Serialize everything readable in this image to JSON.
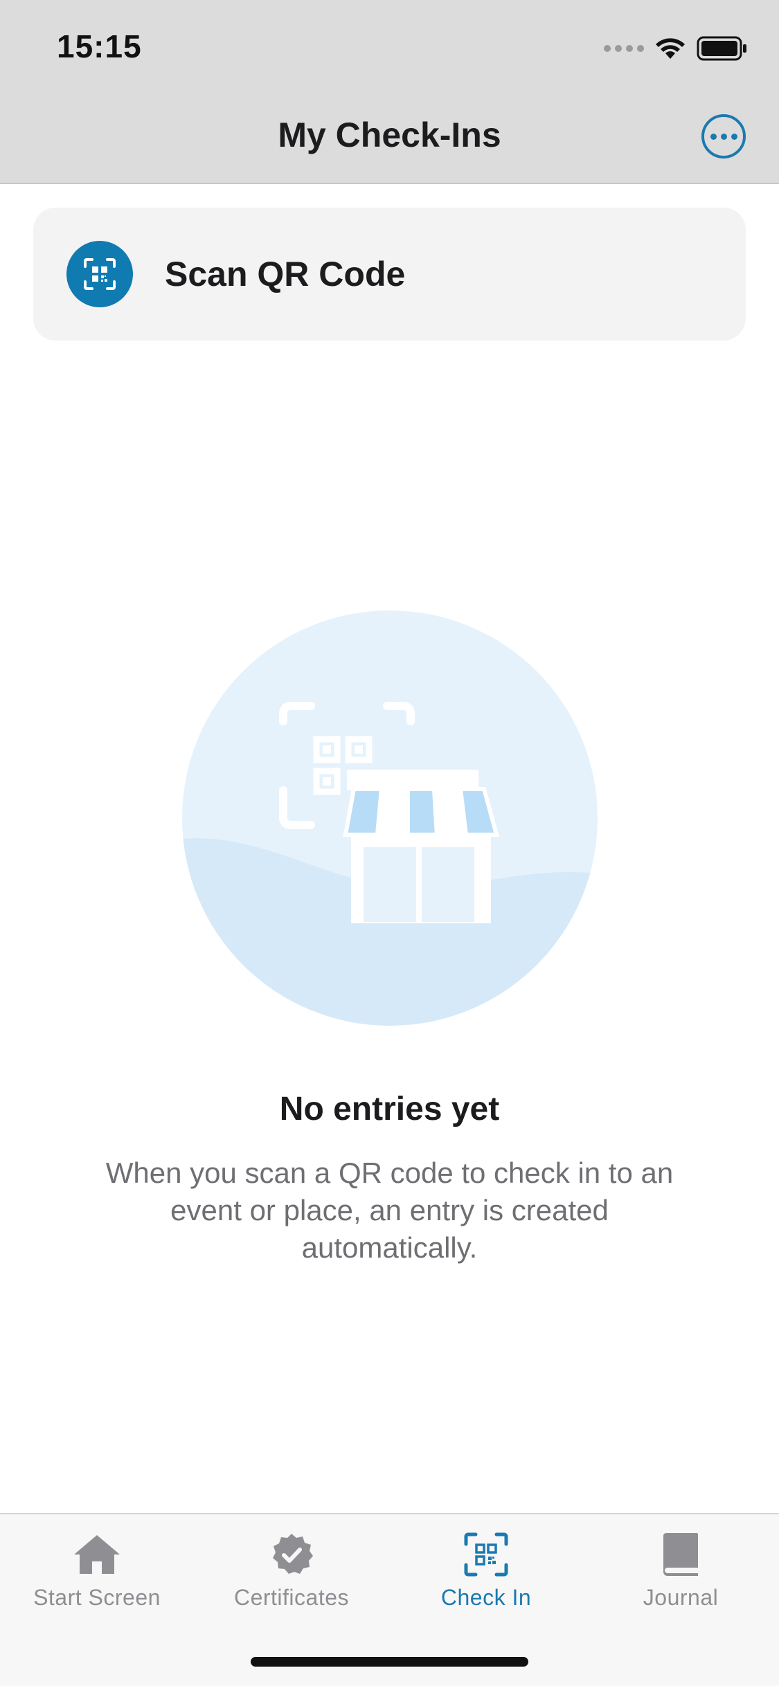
{
  "status_bar": {
    "time": "15:15"
  },
  "nav": {
    "title": "My Check-Ins",
    "more_icon": "ellipsis-circle-icon"
  },
  "scan": {
    "label": "Scan QR Code",
    "icon": "qr-scan-icon"
  },
  "empty_state": {
    "title": "No entries yet",
    "description": "When you scan a QR code to check in to an event or place, an entry is created automatically."
  },
  "tabbar": {
    "tabs": [
      {
        "label": "Start Screen",
        "icon": "home-icon",
        "active": false
      },
      {
        "label": "Certificates",
        "icon": "certificate-badge-icon",
        "active": false
      },
      {
        "label": "Check In",
        "icon": "qr-scan-icon",
        "active": true
      },
      {
        "label": "Journal",
        "icon": "book-icon",
        "active": false
      }
    ]
  },
  "colors": {
    "accent": "#1a7ab0",
    "scan_icon_bg": "#0f7bb0",
    "inactive_tab": "#8e8e93",
    "illustration_light": "#e6f2fb",
    "illustration_mid": "#d6e9f8",
    "awning": "#b7dcf7"
  }
}
